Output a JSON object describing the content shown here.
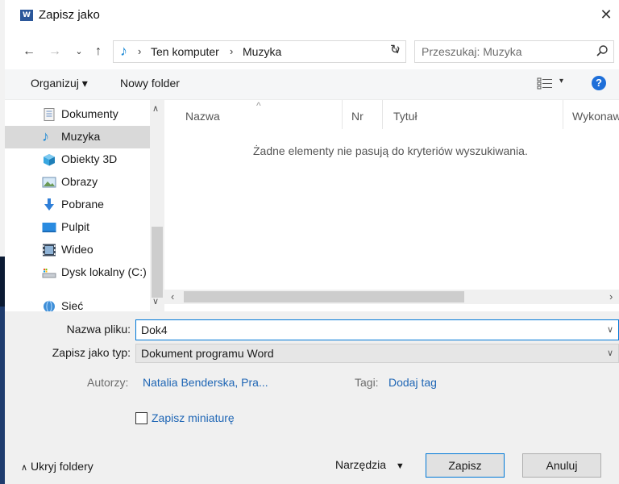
{
  "window": {
    "title": "Zapisz jako",
    "app_icon_text": "W",
    "close_glyph": "✕"
  },
  "address": {
    "breadcrumbs": [
      "Ten komputer",
      "Muzyka"
    ],
    "separator": "›"
  },
  "search": {
    "placeholder": "Przeszukaj: Muzyka"
  },
  "toolbar": {
    "organize_label": "Organizuj ▾",
    "new_folder_label": "Nowy folder",
    "help_glyph": "?"
  },
  "nav_pane": {
    "items": [
      {
        "label": "Dokumenty",
        "icon": "documents-icon"
      },
      {
        "label": "Muzyka",
        "icon": "music-icon",
        "selected": true
      },
      {
        "label": "Obiekty 3D",
        "icon": "3d-objects-icon"
      },
      {
        "label": "Obrazy",
        "icon": "pictures-icon"
      },
      {
        "label": "Pobrane",
        "icon": "downloads-icon"
      },
      {
        "label": "Pulpit",
        "icon": "desktop-icon"
      },
      {
        "label": "Wideo",
        "icon": "video-icon"
      },
      {
        "label": "Dysk lokalny (C:)",
        "icon": "local-disk-icon"
      },
      {
        "label": "Sieć",
        "icon": "network-icon"
      }
    ]
  },
  "file_list": {
    "columns": [
      "Nazwa",
      "Nr",
      "Tytuł",
      "Wykonawcy"
    ],
    "empty_message": "Żadne elementy nie pasują do kryteriów wyszukiwania."
  },
  "form": {
    "filename_label": "Nazwa pliku:",
    "filename_value": "Dok4",
    "filetype_label": "Zapisz jako typ:",
    "filetype_value": "Dokument programu Word",
    "authors_label": "Autorzy:",
    "authors_value": "Natalia Benderska, Pra...",
    "tags_label": "Tagi:",
    "tags_value": "Dodaj tag",
    "thumbnail_label": "Zapisz miniaturę"
  },
  "footer": {
    "hide_folders_label": "Ukryj foldery",
    "tools_label": "Narzędzia",
    "save_label": "Zapisz",
    "cancel_label": "Anuluj"
  },
  "colors": {
    "accent": "#0078d7",
    "link": "#1f66b5",
    "word_blue": "#2b579a",
    "selected_bg": "#d9d9d9"
  }
}
